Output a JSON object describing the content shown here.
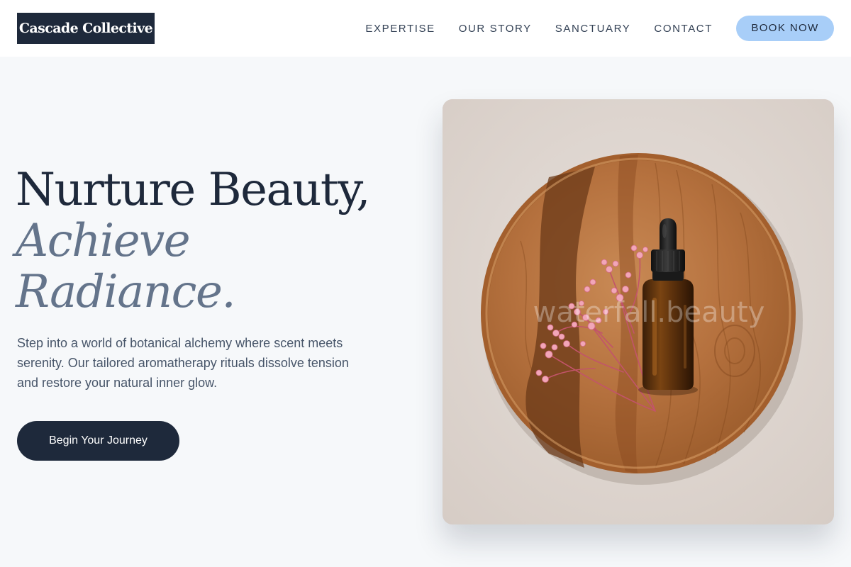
{
  "brand": {
    "name": "Cascade Collective"
  },
  "nav": {
    "items": [
      {
        "label": "EXPERTISE"
      },
      {
        "label": "OUR STORY"
      },
      {
        "label": "SANCTUARY"
      },
      {
        "label": "CONTACT"
      }
    ],
    "cta_label": "BOOK NOW"
  },
  "hero": {
    "headline_line1": "Nurture Beauty,",
    "headline_line2": "Achieve",
    "headline_line3": "Radiance.",
    "body": "Step into a world of botanical alchemy where scent meets serenity. Our tailored aromatherapy rituals dissolve tension and restore your natural inner glow.",
    "cta_label": "Begin Your Journey"
  },
  "image": {
    "subject": "amber dropper bottle with pink dried flowers on a round wooden plate",
    "watermark": "waterfall.beauty"
  },
  "colors": {
    "navy": "#1e293b",
    "slate_accent": "#64748b",
    "book_button": "#a8cef8",
    "background": "#f6f8fa"
  }
}
